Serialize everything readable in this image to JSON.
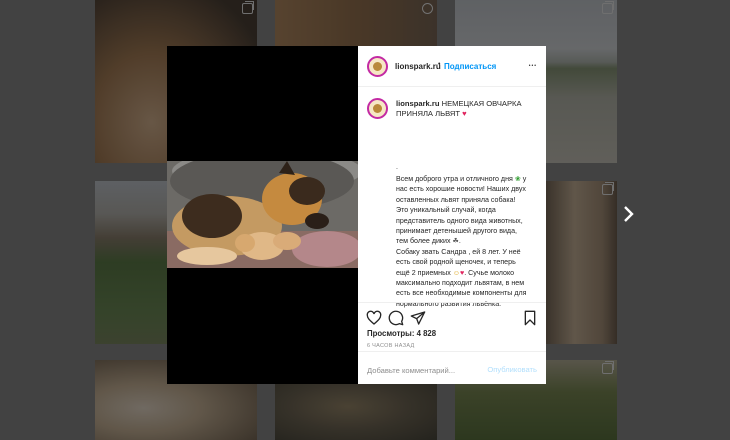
{
  "post": {
    "username": "lionspark.ru",
    "follow_label": "Подписаться",
    "separator": "•",
    "more_label": "•••",
    "caption_title": "НЕМЕЦКАЯ ОВЧАРКА ПРИНЯЛА ЛЬВЯТ",
    "caption_dot": ".",
    "caption_paragraph_1_a": "Всем доброго утра и отличного дня",
    "caption_paragraph_1_b": "у нас есть хорошие новости! Наших двух оставленных львят приняла собака! Это уникальный случай, когда представитель одного вида животных, принимает детенышей другого вида, тем более диких",
    "caption_paragraph_2_a": "Собаку звать Сандра , ей 8 лет. У неё есть свой родной щеночек, и теперь ещё 2 приемных",
    "caption_paragraph_2_b": ". Сучье молоко максимально подходит львятам, в нем есть все необходимые компоненты для нормального развития львёнка.",
    "views_label": "Просмотры: 4 828",
    "time_label": "6 ЧАСОВ НАЗАД",
    "comment_placeholder": "Добавьте комментарий...",
    "publish_label": "Опубликовать"
  },
  "icons": [
    "like-icon",
    "comment-icon",
    "share-icon",
    "save-icon",
    "more-icon",
    "next-arrow-icon",
    "multi-post-icon",
    "video-icon"
  ],
  "colors": {
    "follow": "#0095f6",
    "heart": "#e0245e",
    "overlay": "rgba(0,0,0,0.52)"
  }
}
